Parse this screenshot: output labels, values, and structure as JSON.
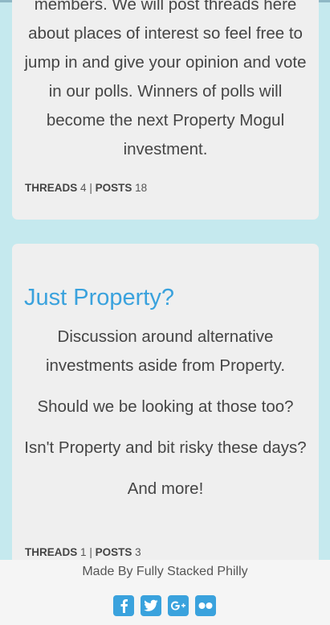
{
  "forum_cards": [
    {
      "title": "",
      "description_lines": [
        "members.  We will post threads here about places of interest so feel free to jump in and give your opinion and vote in our polls.  Winners of polls will become the next Property Mogul investment."
      ],
      "threads_label": "THREADS",
      "threads_count": "4",
      "separator": "|",
      "posts_label": "POSTS",
      "posts_count": "18"
    },
    {
      "title": "Just Property?",
      "description_lines": [
        "Discussion around alternative investments aside from Property.",
        "Should we be looking at those too?",
        "Isn't Property and bit risky these days?",
        "And more!"
      ],
      "threads_label": "THREADS",
      "threads_count": "1",
      "separator": "|",
      "posts_label": "POSTS",
      "posts_count": "3"
    }
  ],
  "footer": {
    "credit": "Made By Fully Stacked Philly",
    "social_icons": [
      "facebook-icon",
      "twitter-icon",
      "google-plus-icon",
      "flickr-icon"
    ]
  },
  "colors": {
    "background": "#c5e9ee",
    "card": "#efefef",
    "accent": "#3aa2dd",
    "text": "#454545"
  }
}
